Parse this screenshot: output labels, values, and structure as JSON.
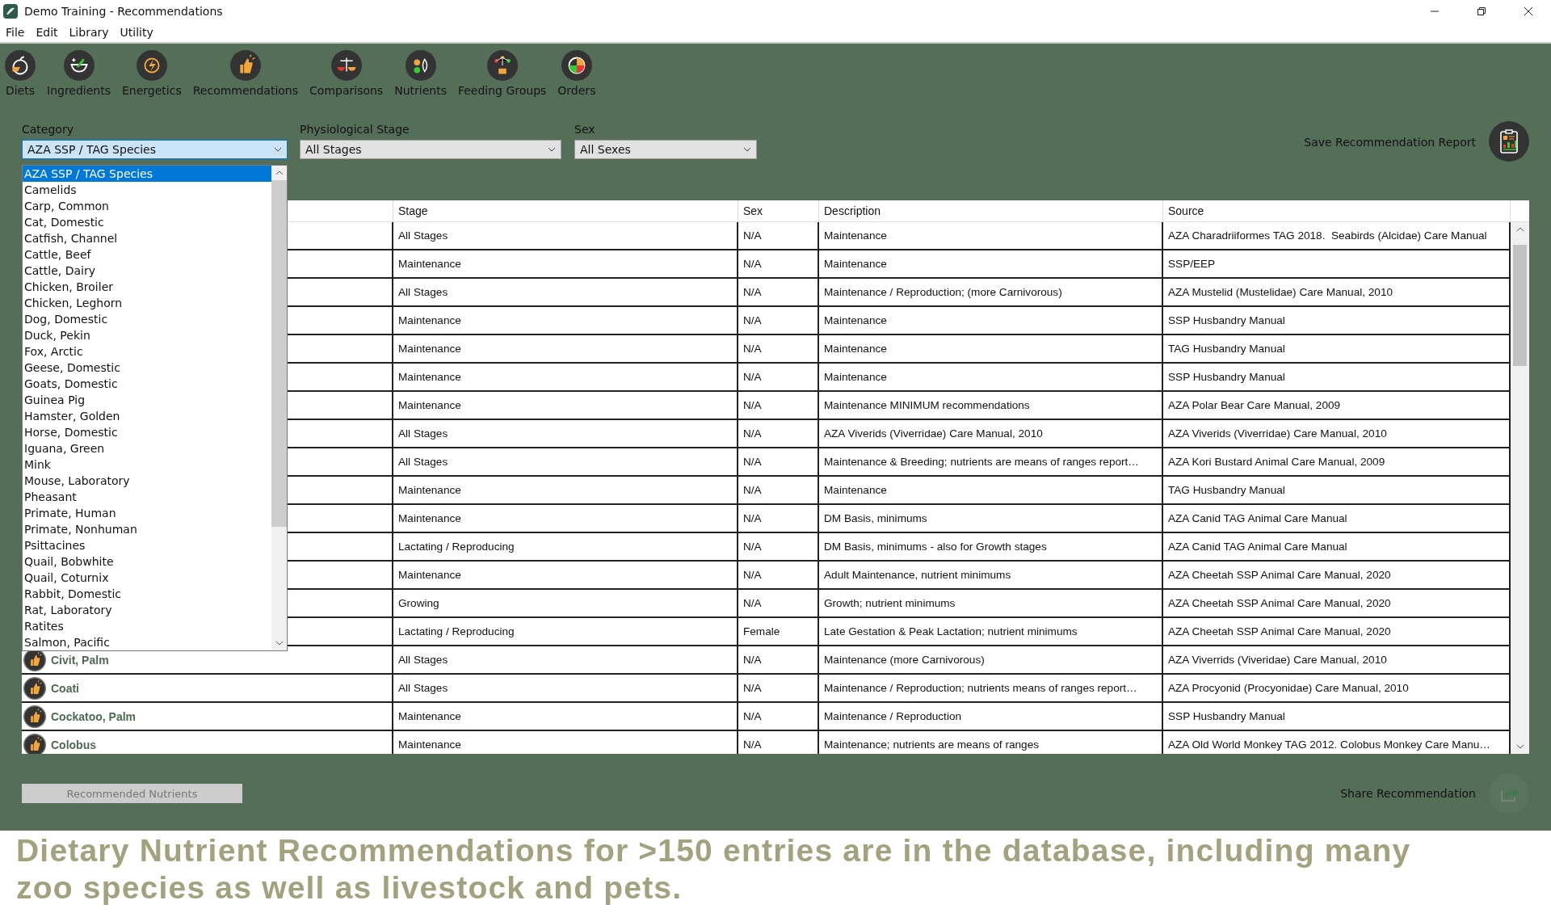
{
  "window": {
    "title": "Demo Training - Recommendations"
  },
  "menu": [
    "File",
    "Edit",
    "Library",
    "Utility"
  ],
  "toolbar": [
    {
      "label": "Diets"
    },
    {
      "label": "Ingredients"
    },
    {
      "label": "Energetics"
    },
    {
      "label": "Recommendations"
    },
    {
      "label": "Comparisons"
    },
    {
      "label": "Nutrients"
    },
    {
      "label": "Feeding Groups"
    },
    {
      "label": "Orders"
    }
  ],
  "filters": {
    "category": {
      "label": "Category",
      "value": "AZA SSP / TAG Species",
      "expanded": true,
      "options": [
        {
          "label": "AZA SSP / TAG Species",
          "selected": true
        },
        {
          "label": "Camelids",
          "selected": false
        },
        {
          "label": "Carp, Common",
          "selected": false
        },
        {
          "label": "Cat, Domestic",
          "selected": false
        },
        {
          "label": "Catfish, Channel",
          "selected": false
        },
        {
          "label": "Cattle, Beef",
          "selected": false
        },
        {
          "label": "Cattle, Dairy",
          "selected": false
        },
        {
          "label": "Chicken, Broiler",
          "selected": false
        },
        {
          "label": "Chicken, Leghorn",
          "selected": false
        },
        {
          "label": "Dog, Domestic",
          "selected": false
        },
        {
          "label": "Duck, Pekin",
          "selected": false
        },
        {
          "label": "Fox, Arctic",
          "selected": false
        },
        {
          "label": "Geese, Domestic",
          "selected": false
        },
        {
          "label": "Goats, Domestic",
          "selected": false
        },
        {
          "label": "Guinea Pig",
          "selected": false
        },
        {
          "label": "Hamster, Golden",
          "selected": false
        },
        {
          "label": "Horse, Domestic",
          "selected": false
        },
        {
          "label": "Iguana, Green",
          "selected": false
        },
        {
          "label": "Mink",
          "selected": false
        },
        {
          "label": "Mouse, Laboratory",
          "selected": false
        },
        {
          "label": "Pheasant",
          "selected": false
        },
        {
          "label": "Primate, Human",
          "selected": false
        },
        {
          "label": "Primate, Nonhuman",
          "selected": false
        },
        {
          "label": "Psittacines",
          "selected": false
        },
        {
          "label": "Quail, Bobwhite",
          "selected": false
        },
        {
          "label": "Quail, Coturnix",
          "selected": false
        },
        {
          "label": "Rabbit, Domestic",
          "selected": false
        },
        {
          "label": "Rat, Laboratory",
          "selected": false
        },
        {
          "label": "Ratites",
          "selected": false
        },
        {
          "label": "Salmon, Pacific",
          "selected": false
        }
      ]
    },
    "stage": {
      "label": "Physiological Stage",
      "value": "All Stages"
    },
    "sex": {
      "label": "Sex",
      "value": "All Sexes"
    }
  },
  "save_report": {
    "label": "Save Recommendation Report"
  },
  "table": {
    "columns": [
      "Stage",
      "Sex",
      "Description",
      "Source"
    ],
    "rows": [
      {
        "stage": "All Stages",
        "sex": "N/A",
        "description": "Maintenance",
        "source": "AZA Charadriiformes TAG 2018.  Seabirds (Alcidae) Care Manual"
      },
      {
        "stage": "Maintenance",
        "sex": "N/A",
        "description": "Maintenance",
        "source": "SSP/EEP"
      },
      {
        "stage": "All Stages",
        "sex": "N/A",
        "description": "Maintenance / Reproduction; (more Carnivorous)",
        "source": "AZA Mustelid (Mustelidae) Care Manual, 2010"
      },
      {
        "stage": "Maintenance",
        "sex": "N/A",
        "description": "Maintenance",
        "source": "SSP Husbandry Manual"
      },
      {
        "stage": "Maintenance",
        "sex": "N/A",
        "description": "Maintenance",
        "source": "TAG Husbandry Manual"
      },
      {
        "stage": "Maintenance",
        "sex": "N/A",
        "description": "Maintenance",
        "source": "SSP Husbandry Manual"
      },
      {
        "stage": "Maintenance",
        "sex": "N/A",
        "description": "Maintenance MINIMUM recommendations",
        "source": "AZA Polar Bear Care Manual, 2009"
      },
      {
        "stage": "All Stages",
        "sex": "N/A",
        "description": "AZA Viverids (Viverridae) Care Manual, 2010",
        "source": "AZA Viverids (Viverridae) Care Manual, 2010"
      },
      {
        "stage": "All Stages",
        "sex": "N/A",
        "description": "Maintenance & Breeding; nutrients are means of ranges report…",
        "source": "AZA Kori Bustard Animal Care Manual, 2009"
      },
      {
        "stage": "Maintenance",
        "sex": "N/A",
        "description": "Maintenance",
        "source": "TAG Husbandry Manual"
      },
      {
        "stage": "Maintenance",
        "sex": "N/A",
        "description": "DM Basis, minimums",
        "source": "AZA Canid TAG Animal Care Manual"
      },
      {
        "stage": "Lactating / Reproducing",
        "sex": "N/A",
        "description": "DM Basis, minimums - also for Growth stages",
        "source": "AZA Canid TAG Animal Care Manual"
      },
      {
        "stage": "Maintenance",
        "sex": "N/A",
        "description": "Adult Maintenance, nutrient minimums",
        "source": "AZA Cheetah SSP Animal Care Manual, 2020"
      },
      {
        "stage": "Growing",
        "sex": "N/A",
        "description": "Growth; nutrient minimums",
        "source": "AZA Cheetah SSP Animal Care Manual, 2020"
      },
      {
        "stage": "Lactating / Reproducing",
        "sex": "Female",
        "description": "Late Gestation & Peak Lactation; nutrient minimums",
        "source": "AZA Cheetah SSP Animal Care Manual, 2020"
      },
      {
        "name": "Civit, Palm",
        "stage": "All Stages",
        "sex": "N/A",
        "description": "Maintenance (more Carnivorous)",
        "source": "AZA Viverrids (Viveridae) Care Manual, 2010"
      },
      {
        "name": "Coati",
        "stage": "All Stages",
        "sex": "N/A",
        "description": "Maintenance / Reproduction; nutrients means of ranges report…",
        "source": "AZA Procyonid (Procyonidae) Care Manual, 2010"
      },
      {
        "name": "Cockatoo, Palm",
        "stage": "Maintenance",
        "sex": "N/A",
        "description": "Maintenance / Reproduction",
        "source": "SSP Husbandry Manual"
      },
      {
        "name": "Colobus",
        "stage": "Maintenance",
        "sex": "N/A",
        "description": "Maintenance; nutrients are means of ranges",
        "source": "AZA Old World Monkey TAG 2012. Colobus Monkey Care Manu…"
      }
    ]
  },
  "recommended_nutrients": {
    "label": "Recommended Nutrients",
    "disabled": true
  },
  "share": {
    "label": "Share Recommendation",
    "disabled": true
  },
  "caption": "Dietary Nutrient Recommendations for >150 entries are in the database, including many zoo species as well as livestock and pets."
}
